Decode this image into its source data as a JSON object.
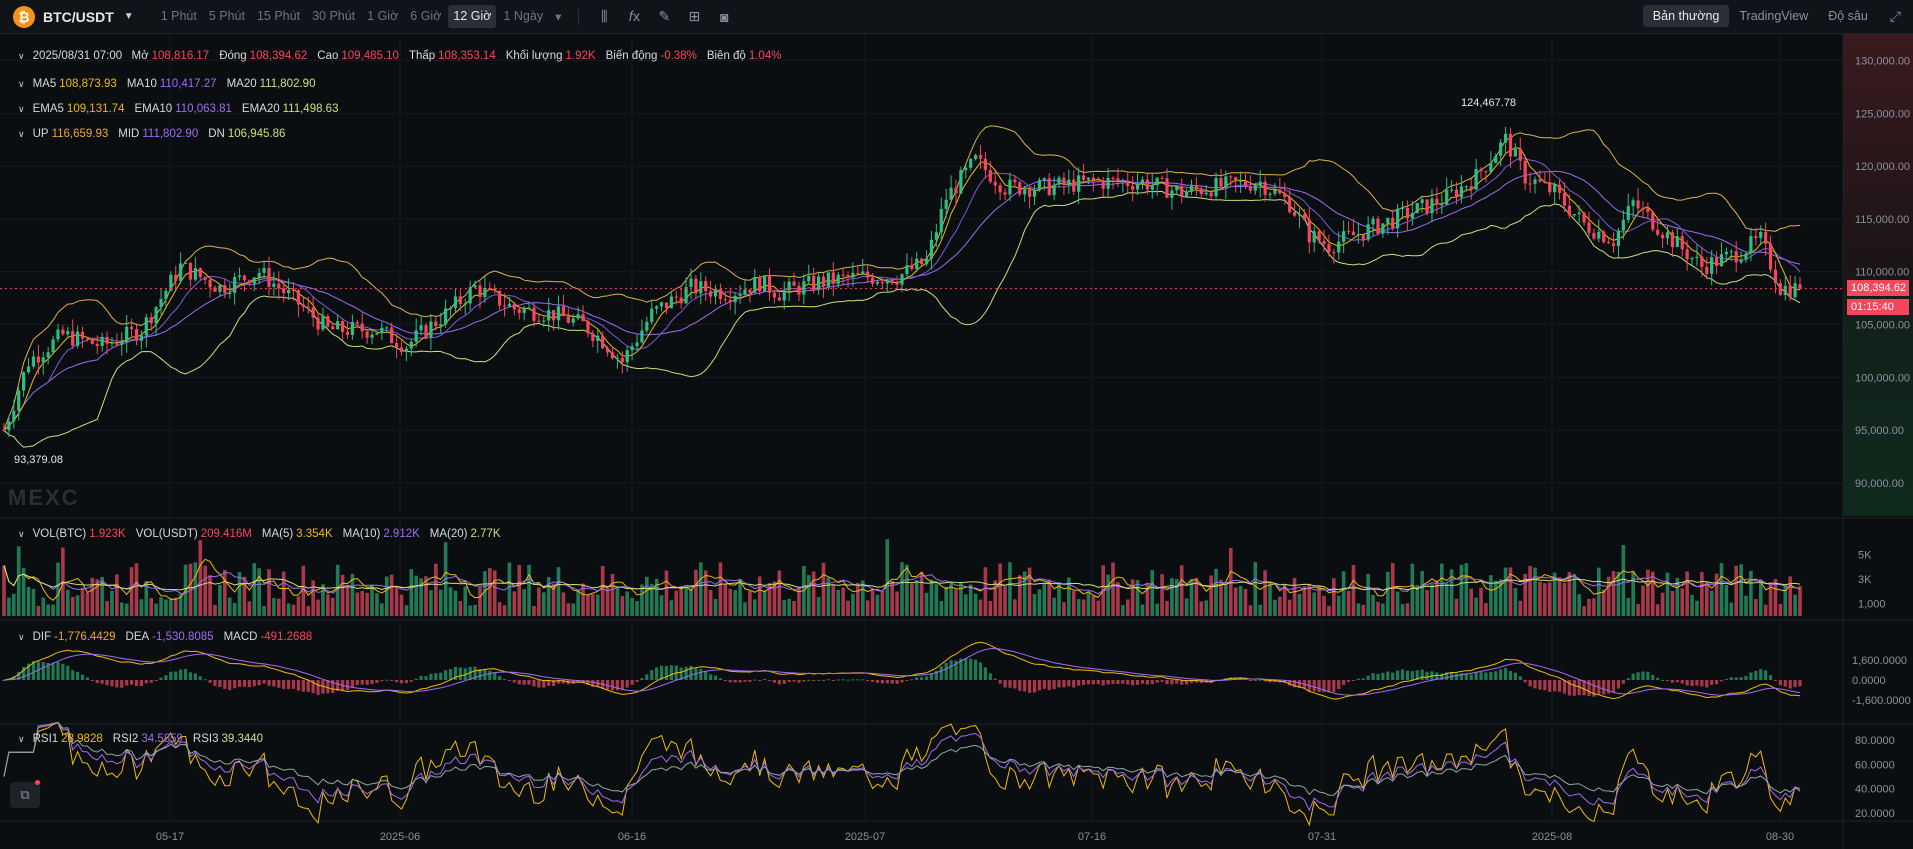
{
  "toolbar": {
    "coin_symbol": "₿",
    "pair": "BTC/USDT",
    "intervals": [
      "1 Phút",
      "5 Phút",
      "15 Phút",
      "30 Phút",
      "1 Giờ",
      "6 Giờ",
      "12 Giờ",
      "1 Ngày"
    ],
    "active_interval": "12 Giờ",
    "views": [
      "Bản thường",
      "TradingView",
      "Độ sâu"
    ],
    "active_view": "Bản thường"
  },
  "legend": {
    "date": "2025/08/31 07:00",
    "open_label": "Mở",
    "open": "108,816.17",
    "close_label": "Đóng",
    "close": "108,394.62",
    "high_label": "Cao",
    "high": "109,485.10",
    "low_label": "Thấp",
    "low": "108,353.14",
    "volume_label": "Khối lượng",
    "volume": "1.92K",
    "change_label": "Biến động",
    "change": "-0.38%",
    "amplitude_label": "Biên độ",
    "amplitude": "1.04%",
    "ma5_label": "MA5",
    "ma5": "108,873.93",
    "ma10_label": "MA10",
    "ma10": "110,417.27",
    "ma20_label": "MA20",
    "ma20": "111,802.90",
    "ema5_label": "EMA5",
    "ema5": "109,131.74",
    "ema10_label": "EMA10",
    "ema10": "110,063.81",
    "ema20_label": "EMA20",
    "ema20": "111,498.63",
    "up_label": "UP",
    "up": "116,659.93",
    "mid_label": "MID",
    "mid": "111,802.90",
    "dn_label": "DN",
    "dn": "106,945.86"
  },
  "volume_legend": {
    "vol_btc_label": "VOL(BTC)",
    "vol_btc": "1.923K",
    "vol_usdt_label": "VOL(USDT)",
    "vol_usdt": "209.416M",
    "ma5_label": "MA(5)",
    "ma5": "3.354K",
    "ma10_label": "MA(10)",
    "ma10": "2.912K",
    "ma20_label": "MA(20)",
    "ma20": "2.77K"
  },
  "macd_legend": {
    "dif_label": "DIF",
    "dif": "-1,776.4429",
    "dea_label": "DEA",
    "dea": "-1,530.8085",
    "macd_label": "MACD",
    "macd": "-491.2688"
  },
  "rsi_legend": {
    "rsi1_label": "RSI1",
    "rsi1": "28.9828",
    "rsi2_label": "RSI2",
    "rsi2": "34.5859",
    "rsi3_label": "RSI3",
    "rsi3": "39.3440"
  },
  "price_axis": [
    "130,000.00",
    "125,000.00",
    "120,000.00",
    "115,000.00",
    "110,000.00",
    "105,000.00",
    "100,000.00",
    "95,000.00",
    "90,000.00"
  ],
  "volume_axis": [
    "5K",
    "3K",
    "1,000"
  ],
  "macd_axis": [
    "1,600.0000",
    "0.0000",
    "-1,600.0000"
  ],
  "rsi_axis": [
    "80.0000",
    "60.0000",
    "40.0000",
    "20.0000"
  ],
  "time_axis": [
    "05-17",
    "2025-06",
    "06-16",
    "2025-07",
    "07-16",
    "07-31",
    "2025-08",
    "08-30"
  ],
  "current_price": "108,394.62",
  "countdown": "01:15:40",
  "peak_label": "124,467.78",
  "trough_label": "93,379.08",
  "watermark": "MEXC",
  "colors": {
    "up": "#2ebd85",
    "down": "#f6465d",
    "ma5": "#f0b90b",
    "ma10": "#a06cf0",
    "ma20": "#c8e07d",
    "boll": "#d9b24a"
  },
  "chart_data": {
    "type": "candlestick",
    "ylim": [
      88000,
      131000
    ],
    "price_path": [
      [
        0,
        95000
      ],
      [
        5,
        101500
      ],
      [
        12,
        104000
      ],
      [
        20,
        103000
      ],
      [
        28,
        104500
      ],
      [
        36,
        110500
      ],
      [
        44,
        108500
      ],
      [
        52,
        110000
      ],
      [
        60,
        107000
      ],
      [
        66,
        104500
      ],
      [
        76,
        104500
      ],
      [
        82,
        103000
      ],
      [
        90,
        106000
      ],
      [
        96,
        108500
      ],
      [
        104,
        106500
      ],
      [
        112,
        106000
      ],
      [
        118,
        105000
      ],
      [
        122,
        103500
      ],
      [
        126,
        101500
      ],
      [
        132,
        106000
      ],
      [
        140,
        108500
      ],
      [
        148,
        108000
      ],
      [
        154,
        109000
      ],
      [
        158,
        108000
      ],
      [
        166,
        109000
      ],
      [
        174,
        109500
      ],
      [
        182,
        109500
      ],
      [
        188,
        111000
      ],
      [
        192,
        117000
      ],
      [
        198,
        120500
      ],
      [
        204,
        118000
      ],
      [
        212,
        118000
      ],
      [
        222,
        118500
      ],
      [
        232,
        118500
      ],
      [
        240,
        117500
      ],
      [
        246,
        118000
      ],
      [
        256,
        118500
      ],
      [
        262,
        116500
      ],
      [
        266,
        113500
      ],
      [
        270,
        112500
      ],
      [
        278,
        114000
      ],
      [
        286,
        115500
      ],
      [
        294,
        117000
      ],
      [
        300,
        119000
      ],
      [
        306,
        122500
      ],
      [
        310,
        119000
      ],
      [
        316,
        117500
      ],
      [
        322,
        114500
      ],
      [
        328,
        113000
      ],
      [
        332,
        116500
      ],
      [
        340,
        113000
      ],
      [
        346,
        110500
      ],
      [
        352,
        111500
      ],
      [
        358,
        113000
      ],
      [
        362,
        108500
      ],
      [
        366,
        108400
      ]
    ],
    "ma5": "108,873.93",
    "ma10": "110,417.27",
    "ma20": "111,802.90"
  }
}
